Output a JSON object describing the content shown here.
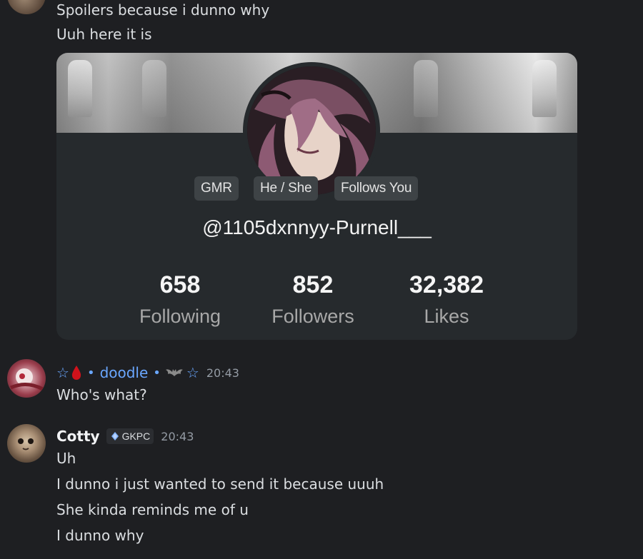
{
  "messages_top": {
    "lines": [
      "Spoilers because i dunno why",
      "Uuh here it is"
    ]
  },
  "profile_card": {
    "tags": [
      "GMR",
      "He / She",
      "Follows You"
    ],
    "handle": "@1105dxnnyy-Purnell___",
    "stats": [
      {
        "value": "658",
        "label": "Following"
      },
      {
        "value": "852",
        "label": "Followers"
      },
      {
        "value": "32,382",
        "label": "Likes"
      }
    ]
  },
  "message_doodle": {
    "prefix": "☆",
    "username": "doodle",
    "suffix": "☆",
    "timestamp": "20:43",
    "text": "Who's what?"
  },
  "message_cotty": {
    "username": "Cotty",
    "clan_tag": "GKPC",
    "timestamp": "20:43",
    "lines": [
      "Uh",
      "I dunno i just wanted to send it because uuuh",
      "She kinda reminds me of u",
      "I dunno why"
    ]
  },
  "icons": {
    "blood_drop": "blood-drop-icon",
    "bat": "bat-icon",
    "clan_badge": "clan-badge-icon"
  },
  "colors": {
    "background": "#1e1f22",
    "username_blue": "#6aa7ff",
    "timestamp": "#949ba4",
    "card_bg": "#262a2d"
  }
}
